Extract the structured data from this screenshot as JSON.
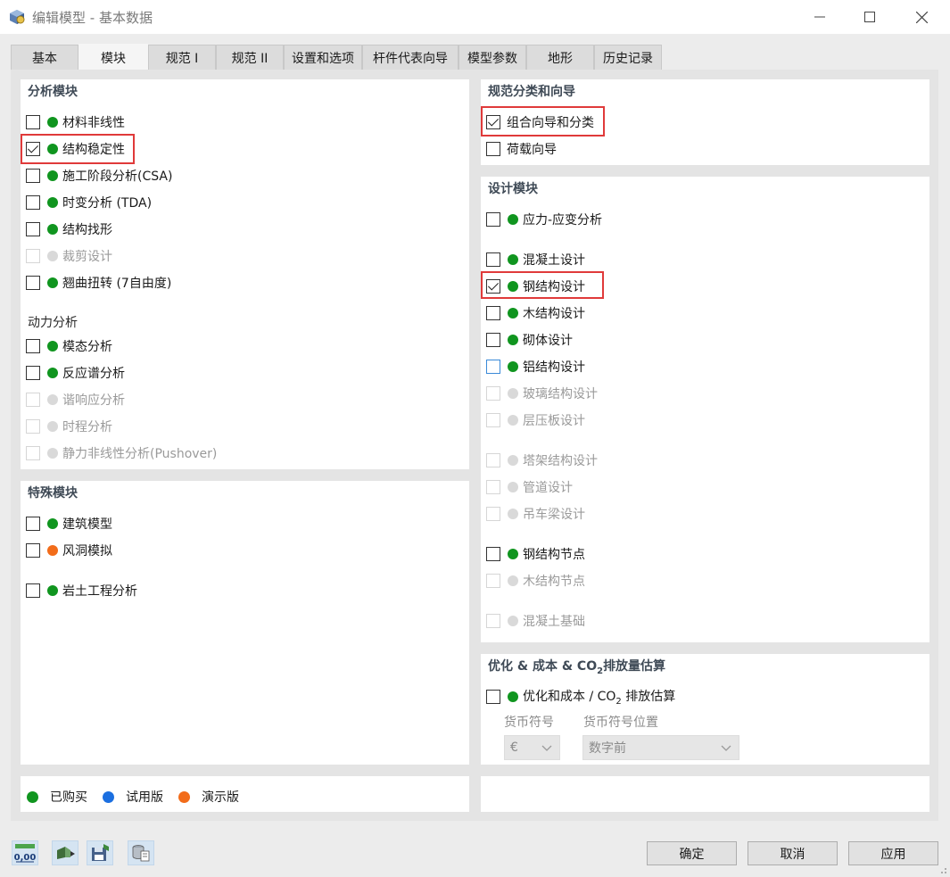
{
  "window": {
    "title": "编辑模型 - 基本数据",
    "icons": {
      "app": "app-cube-icon",
      "minimize": "minimize-icon",
      "maximize": "maximize-icon",
      "close": "close-icon"
    }
  },
  "tabs": [
    {
      "label": "基本"
    },
    {
      "label": "模块",
      "active": true
    },
    {
      "label": "规范 I"
    },
    {
      "label": "规范 II"
    },
    {
      "label": "设置和选项"
    },
    {
      "label": "杆件代表向导"
    },
    {
      "label": "模型参数"
    },
    {
      "label": "地形"
    },
    {
      "label": "历史记录"
    }
  ],
  "colors": {
    "purchased": "#10951f",
    "trial": "#1b6fe0",
    "demo": "#f26c1a",
    "unavailable": "#d9d9d9",
    "highlight": "#e03a3a",
    "panel_title": "#3f4a56"
  },
  "analysis": {
    "title": "分析模块",
    "items": [
      {
        "label": "材料非线性",
        "checked": false,
        "status": "purchased"
      },
      {
        "label": "结构稳定性",
        "checked": true,
        "status": "purchased",
        "highlighted": true
      },
      {
        "label": "施工阶段分析(CSA)",
        "checked": false,
        "status": "purchased"
      },
      {
        "label": "时变分析 (TDA)",
        "checked": false,
        "status": "purchased"
      },
      {
        "label": "结构找形",
        "checked": false,
        "status": "purchased"
      },
      {
        "label": "裁剪设计",
        "checked": false,
        "status": "unavailable",
        "disabled": true
      },
      {
        "label": "翘曲扭转 (7自由度)",
        "checked": false,
        "status": "purchased"
      }
    ],
    "dynamic_title": "动力分析",
    "dynamic_items": [
      {
        "label": "模态分析",
        "checked": false,
        "status": "purchased"
      },
      {
        "label": "反应谱分析",
        "checked": false,
        "status": "purchased"
      },
      {
        "label": "谐响应分析",
        "checked": false,
        "status": "unavailable",
        "disabled": true
      },
      {
        "label": "时程分析",
        "checked": false,
        "status": "unavailable",
        "disabled": true
      },
      {
        "label": "静力非线性分析(Pushover)",
        "checked": false,
        "status": "unavailable",
        "disabled": true
      }
    ]
  },
  "special": {
    "title": "特殊模块",
    "items": [
      {
        "label": "建筑模型",
        "checked": false,
        "status": "purchased"
      },
      {
        "label": "风洞模拟",
        "checked": false,
        "status": "demo"
      },
      {
        "label": "岩土工程分析",
        "checked": false,
        "status": "purchased"
      }
    ]
  },
  "code": {
    "title": "规范分类和向导",
    "items": [
      {
        "label": "组合向导和分类",
        "checked": true,
        "highlighted": true
      },
      {
        "label": "荷载向导",
        "checked": false
      }
    ]
  },
  "design": {
    "title": "设计模块",
    "items": [
      {
        "label": "应力-应变分析",
        "checked": false,
        "status": "purchased"
      },
      {
        "label": "混凝土设计",
        "checked": false,
        "status": "purchased"
      },
      {
        "label": "钢结构设计",
        "checked": true,
        "status": "purchased",
        "highlighted": true
      },
      {
        "label": "木结构设计",
        "checked": false,
        "status": "purchased"
      },
      {
        "label": "砌体设计",
        "checked": false,
        "status": "purchased"
      },
      {
        "label": "铝结构设计",
        "checked": false,
        "status": "purchased",
        "focused": true
      },
      {
        "label": "玻璃结构设计",
        "checked": false,
        "status": "unavailable",
        "disabled": true
      },
      {
        "label": "层压板设计",
        "checked": false,
        "status": "unavailable",
        "disabled": true
      },
      {
        "label": "塔架结构设计",
        "checked": false,
        "status": "unavailable",
        "disabled": true
      },
      {
        "label": "管道设计",
        "checked": false,
        "status": "unavailable",
        "disabled": true
      },
      {
        "label": "吊车梁设计",
        "checked": false,
        "status": "unavailable",
        "disabled": true
      },
      {
        "label": "钢结构节点",
        "checked": false,
        "status": "purchased"
      },
      {
        "label": "木结构节点",
        "checked": false,
        "status": "unavailable",
        "disabled": true
      },
      {
        "label": "混凝土基础",
        "checked": false,
        "status": "unavailable",
        "disabled": true
      }
    ]
  },
  "optimization": {
    "title_pre": "优化 & 成本 & CO",
    "title_sub": "2",
    "title_post": "排放量估算",
    "item": {
      "label_pre": "优化和成本 / CO",
      "label_sub": "2",
      "label_post": " 排放估算",
      "checked": false,
      "status": "purchased"
    },
    "currency_label": "货币符号",
    "currency_value": "€",
    "position_label": "货币符号位置",
    "position_value": "数字前"
  },
  "legend": [
    {
      "label": "已购买",
      "color": "#10951f"
    },
    {
      "label": "试用版",
      "color": "#1b6fe0"
    },
    {
      "label": "演示版",
      "color": "#f26c1a"
    }
  ],
  "toolbar": {
    "zero_text": "0,00",
    "icons": [
      "units-zero-icon",
      "export-model-icon",
      "save-template-icon",
      "database-copy-icon"
    ]
  },
  "buttons": {
    "ok": "确定",
    "cancel": "取消",
    "apply": "应用"
  }
}
